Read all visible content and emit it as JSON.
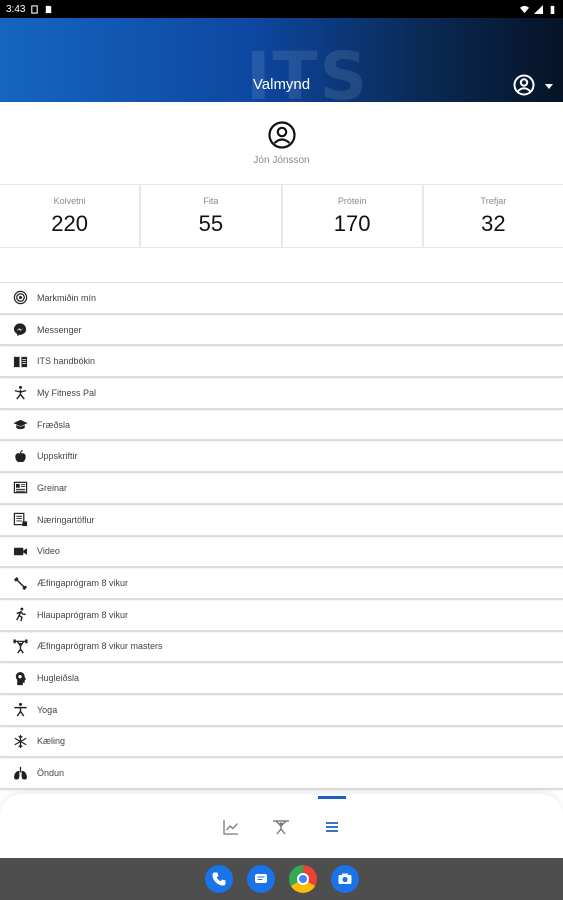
{
  "status_bar": {
    "time": "3:43"
  },
  "header": {
    "title": "Valmynd",
    "logo_text": "ITS"
  },
  "profile": {
    "name": "Jón Jónsson"
  },
  "stats": [
    {
      "label": "Kolvetni",
      "value": "220"
    },
    {
      "label": "Fita",
      "value": "55"
    },
    {
      "label": "Prótein",
      "value": "170"
    },
    {
      "label": "Trefjar",
      "value": "32"
    }
  ],
  "menu": {
    "items": [
      {
        "label": "Markmiðin mín",
        "icon": "target-icon"
      },
      {
        "label": "Messenger",
        "icon": "messenger-icon"
      },
      {
        "label": "ITS handbókin",
        "icon": "book-icon"
      },
      {
        "label": "My Fitness Pal",
        "icon": "figure-icon"
      },
      {
        "label": "Fræðsla",
        "icon": "graduation-cap-icon"
      },
      {
        "label": "Uppskriftir",
        "icon": "apple-icon"
      },
      {
        "label": "Greinar",
        "icon": "newspaper-icon"
      },
      {
        "label": "Næringartöflur",
        "icon": "table-icon"
      },
      {
        "label": "Video",
        "icon": "video-camera-icon"
      },
      {
        "label": "Æfingaprógram 8 vikur",
        "icon": "dumbbell-icon"
      },
      {
        "label": "Hlaupaprógram 8 vikur",
        "icon": "runner-icon"
      },
      {
        "label": "Æfingaprógram 8 vikur masters",
        "icon": "weightlifter-icon"
      },
      {
        "label": "Hugleiðsla",
        "icon": "head-icon"
      },
      {
        "label": "Yoga",
        "icon": "yoga-icon"
      },
      {
        "label": "Kæling",
        "icon": "snowflake-icon"
      },
      {
        "label": "Öndun",
        "icon": "lungs-icon"
      }
    ]
  },
  "bottom_nav": [
    {
      "name": "chart-icon"
    },
    {
      "name": "workout-icon"
    },
    {
      "name": "menu-icon",
      "active": true
    }
  ],
  "colors": {
    "header_start": "#1565c0",
    "header_end": "#061326",
    "accent": "#1e5fbf"
  }
}
